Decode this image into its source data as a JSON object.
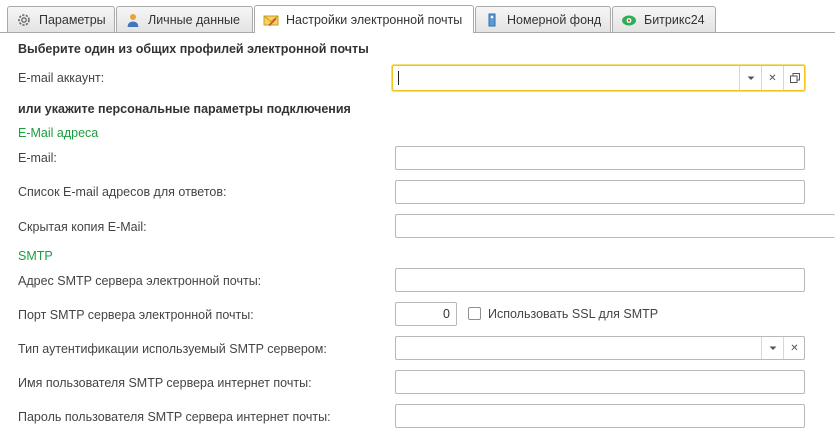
{
  "tabs": [
    {
      "label": "Параметры",
      "icon": "gear-icon"
    },
    {
      "label": "Личные данные",
      "icon": "user-icon"
    },
    {
      "label": "Настройки электронной почты",
      "icon": "mail-icon",
      "active": true
    },
    {
      "label": "Номерной фонд",
      "icon": "door-tag-icon"
    },
    {
      "label": "Битрикс24",
      "icon": "bitrix24-logo-icon"
    }
  ],
  "profile_section": {
    "heading": "Выберите один из общих профилей электронной почты",
    "account_label": "E-mail аккаунт:",
    "account_value": ""
  },
  "personal_section": {
    "heading": "или укажите персональные параметры подключения"
  },
  "email_group": {
    "title": "E-Mail адреса",
    "email_label": "E-mail:",
    "email_value": "",
    "reply_list_label": "Список E-mail адресов для ответов:",
    "reply_list_value": "",
    "bcc_label": "Скрытая копия E-Mail:",
    "bcc_value": ""
  },
  "smtp_group": {
    "title": "SMTP",
    "server_label": "Адрес SMTP сервера электронной почты:",
    "server_value": "",
    "port_label": "Порт SMTP сервера электронной почты:",
    "port_value": "0",
    "ssl_label": "Использовать SSL для SMTP",
    "ssl_checked": false,
    "auth_label": "Тип аутентификации используемый SMTP сервером:",
    "auth_value": "",
    "user_label": "Имя пользователя SMTP сервера интернет почты:",
    "user_value": "",
    "password_label": "Пароль пользователя SMTP сервера интернет почты:",
    "password_value": ""
  },
  "colors": {
    "group_title": "#1b9e3e",
    "focus_border": "#f0c419",
    "border": "#b8b8b8"
  }
}
